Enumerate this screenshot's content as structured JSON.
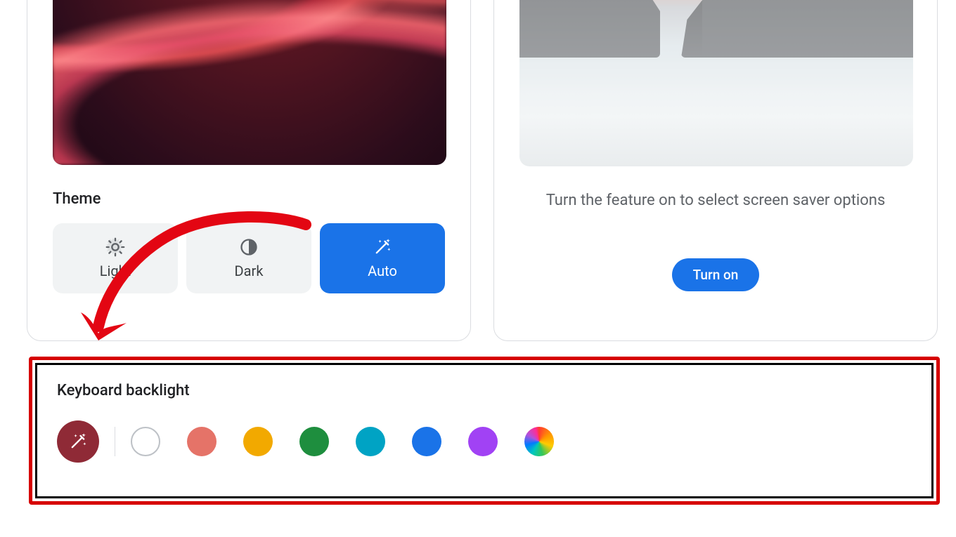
{
  "theme": {
    "section_title": "Theme",
    "options": {
      "light": {
        "label": "Light",
        "icon": "brightness-icon",
        "selected": false
      },
      "dark": {
        "label": "Dark",
        "icon": "contrast-icon",
        "selected": false
      },
      "auto": {
        "label": "Auto",
        "icon": "magic-wand-icon",
        "selected": true
      }
    }
  },
  "screensaver": {
    "caption": "Turn the feature on to select screen saver options",
    "turn_on_label": "Turn on"
  },
  "keyboard_backlight": {
    "title": "Keyboard backlight",
    "lead_icon": "magic-wand-icon",
    "selected_index": 0,
    "swatches": [
      {
        "id": "wallpaper-tone",
        "kind": "auto",
        "color": "#8f2a36"
      },
      {
        "id": "white",
        "kind": "solid",
        "color": "#ffffff"
      },
      {
        "id": "red",
        "kind": "solid",
        "color": "#e57368"
      },
      {
        "id": "yellow",
        "kind": "solid",
        "color": "#f2a900"
      },
      {
        "id": "green",
        "kind": "solid",
        "color": "#1e8e3e"
      },
      {
        "id": "teal",
        "kind": "solid",
        "color": "#00a3c4"
      },
      {
        "id": "blue",
        "kind": "solid",
        "color": "#1a73e8"
      },
      {
        "id": "purple",
        "kind": "solid",
        "color": "#a142f4"
      },
      {
        "id": "rainbow",
        "kind": "rainbow",
        "color": null
      }
    ]
  },
  "annotation": {
    "kind": "red-arrow",
    "points_from": "theme-options",
    "points_to": "keyboard-backlight-card"
  },
  "colors": {
    "accent": "#1a73e8",
    "annotation_red": "#d60000"
  }
}
